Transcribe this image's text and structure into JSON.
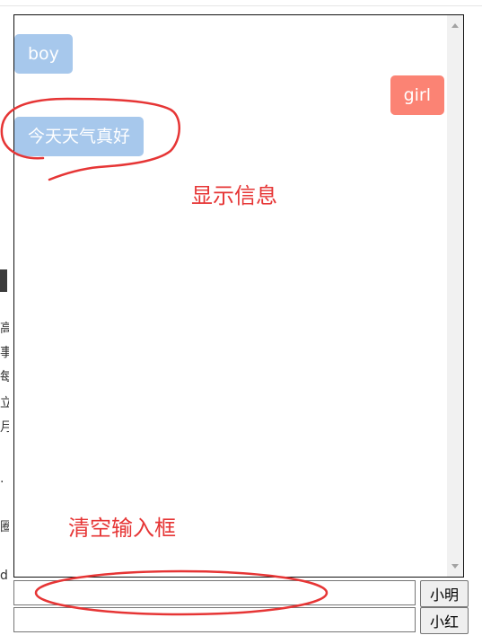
{
  "chat": {
    "messages": [
      {
        "sender": "boy",
        "side": "left",
        "text": "boy"
      },
      {
        "sender": "girl",
        "side": "right",
        "text": "girl"
      },
      {
        "sender": "boy",
        "side": "left",
        "text": "今天天气真好"
      }
    ]
  },
  "annotations": {
    "display_info": "显示信息",
    "clear_input": "清空输入框"
  },
  "inputs": {
    "xiaoming": {
      "value": "",
      "placeholder": "",
      "button_label": "小明"
    },
    "xiaohong": {
      "value": "",
      "placeholder": "",
      "button_label": "小红"
    }
  },
  "left_edge_fragments": [
    "高",
    "事",
    "每",
    "立",
    "月",
    ".",
    "圈",
    "d"
  ],
  "colors": {
    "boy_bubble": "#a7c8ec",
    "girl_bubble": "#fb8374",
    "annotation": "#e63535"
  }
}
